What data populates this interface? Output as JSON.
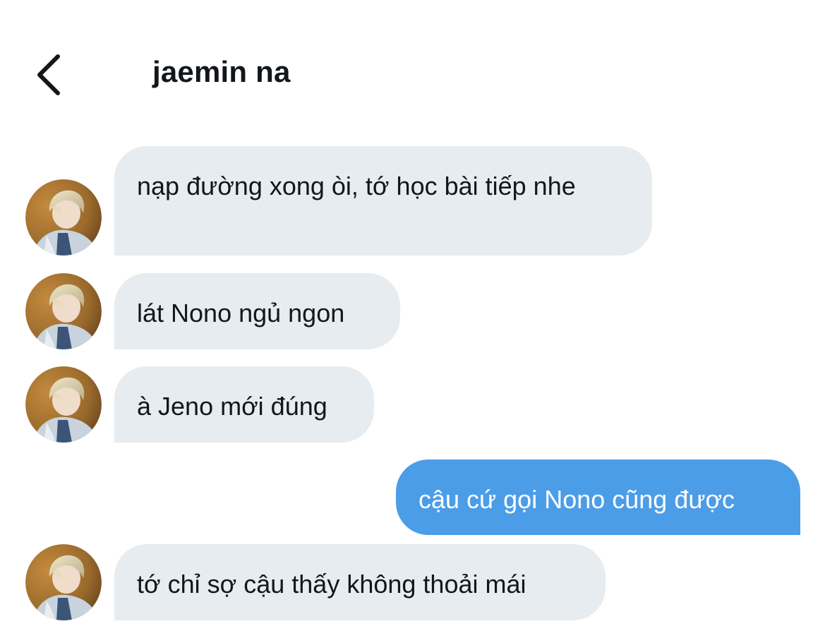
{
  "header": {
    "back_icon": "chevron-left-icon",
    "title": "jaemin na"
  },
  "colors": {
    "incoming_bubble": "#e6ecf0",
    "outgoing_bubble": "#4c9de8",
    "text": "#14171a"
  },
  "messages": [
    {
      "direction": "in",
      "text": "nạp đường xong òi, tớ học bài tiếp nhe"
    },
    {
      "direction": "in",
      "text": "lát Nono ngủ ngon"
    },
    {
      "direction": "in",
      "text": "à Jeno mới đúng"
    },
    {
      "direction": "out",
      "text": "cậu cứ gọi Nono cũng được"
    },
    {
      "direction": "in",
      "text": "tớ chỉ sợ cậu thấy không thoải mái"
    }
  ]
}
